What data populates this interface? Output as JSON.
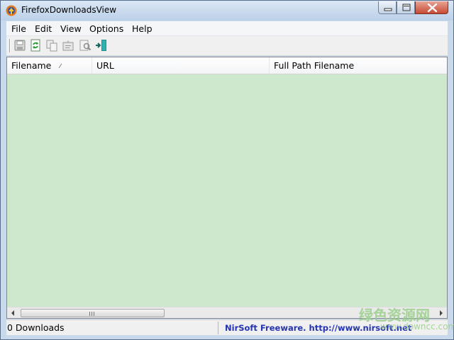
{
  "window": {
    "title": "FirefoxDownloadsView"
  },
  "menu": {
    "items": [
      "File",
      "Edit",
      "View",
      "Options",
      "Help"
    ]
  },
  "toolbar": {
    "buttons": [
      {
        "icon": "save-icon"
      },
      {
        "icon": "refresh-icon"
      },
      {
        "icon": "copy-icon"
      },
      {
        "icon": "properties-icon"
      },
      {
        "icon": "find-icon"
      },
      {
        "icon": "exit-icon"
      }
    ]
  },
  "table": {
    "columns": [
      "Filename",
      "URL",
      "Full Path Filename"
    ],
    "sort_column": "Filename",
    "rows": []
  },
  "status": {
    "count_text": "0 Downloads",
    "link_text": "NirSoft Freeware.  http://www.nirsoft.net"
  },
  "watermark": {
    "cn_text": "绿色资源网",
    "url_text": "www.downcc.com"
  },
  "colors": {
    "list_background": "#cde8cd",
    "link": "#2433b0",
    "watermark": "#9acf8a"
  }
}
